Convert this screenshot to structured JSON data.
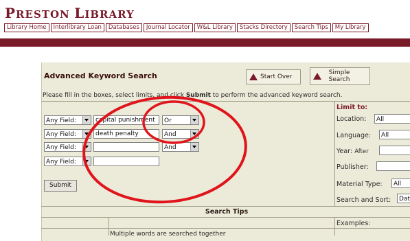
{
  "logo": {
    "first_big": "P",
    "first_small": "RESTON",
    "second_big": "L",
    "second_small": "IBRARY"
  },
  "nav": [
    "Library Home",
    "Interlibrary Loan",
    "Databases",
    "Journal Locator",
    "W&L Library",
    "Stacks Directory",
    "Search Tips",
    "My Library"
  ],
  "search": {
    "title": "Advanced Keyword Search",
    "start_over": "Start Over",
    "simple_search": "Simple Search",
    "instructions": {
      "pre": "Please fill in the boxes, select limits, and click ",
      "bold": "Submit",
      "post": " to perform the advanced keyword search."
    },
    "rows": [
      {
        "field": "Any Field:",
        "value": "capital punishment",
        "operator": "Or"
      },
      {
        "field": "Any Field:",
        "value": "death penalty",
        "operator": "And"
      },
      {
        "field": "Any Field:",
        "value": "",
        "operator": "And"
      },
      {
        "field": "Any Field:",
        "value": ""
      }
    ],
    "submit": "Submit"
  },
  "limits": {
    "title": "Limit to:",
    "location": {
      "label": "Location:",
      "value": "All"
    },
    "language": {
      "label": "Language:",
      "value": "All"
    },
    "year": {
      "label": "Year:",
      "sub": "After",
      "value": ""
    },
    "publisher": {
      "label": "Publisher:",
      "value": ""
    },
    "material": {
      "label": "Material Type:",
      "value": "All"
    },
    "sort": {
      "label": "Search and Sort:",
      "value": "Dat"
    }
  },
  "tips": {
    "title": "Search Tips",
    "examples": "Examples:",
    "text": "Multiple words are searched together"
  },
  "colors": {
    "brand": "#7a1b2a",
    "panel": "#ecebd9",
    "annotation": "#e0141c"
  }
}
